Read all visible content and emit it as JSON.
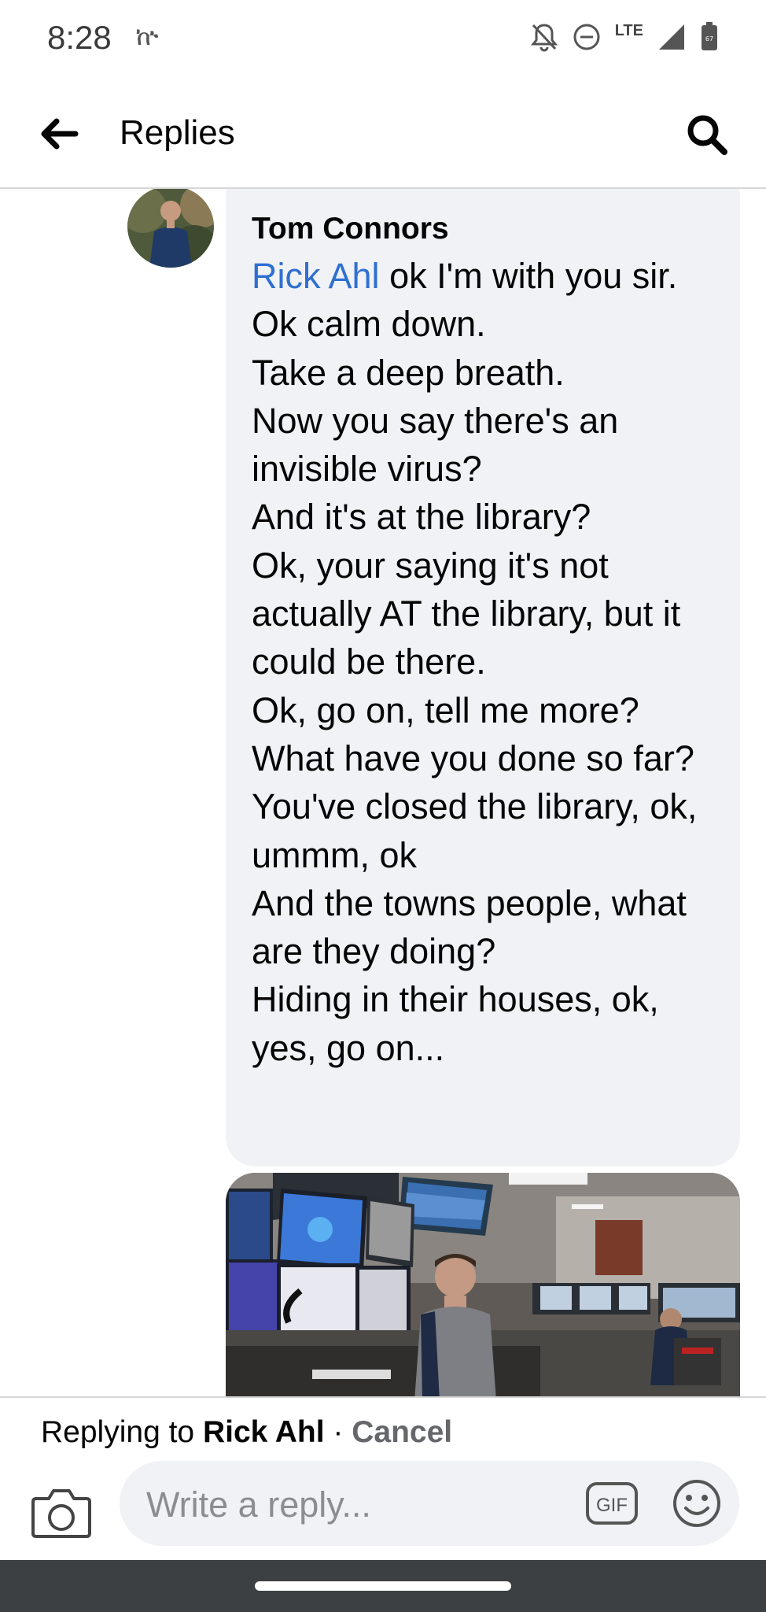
{
  "status_bar": {
    "time": "8:28",
    "glyph": "ኵ",
    "network": "LTE",
    "battery_level": "67",
    "icons": [
      "notifications-off-icon",
      "do-not-disturb-icon",
      "signal-icon",
      "battery-icon"
    ]
  },
  "header": {
    "title": "Replies",
    "back_icon": "arrow-left-icon",
    "search_icon": "search-icon"
  },
  "comment": {
    "author": "Tom Connors",
    "mention": "Rick Ahl",
    "text": " ok I'm with you sir.\nOk calm down.\nTake a deep breath.\nNow you say there's an invisible virus?\nAnd it's at the library?\nOk, your saying it's not actually AT the library, but it could be there.\nOk, go on, tell me more?\nWhat have you done so far?\nYou've closed the library, ok, ummm, ok\nAnd the towns people, what are they doing?\nHiding in their houses, ok, yes, go on..."
  },
  "reply_context": {
    "prefix": "Replying to ",
    "name": "Rick Ahl",
    "separator": " · ",
    "cancel": "Cancel"
  },
  "composer": {
    "placeholder": "Write a reply...",
    "gif_label": "GIF"
  },
  "colors": {
    "mention": "#2f6fd1",
    "bubble": "#f0f2f5",
    "nav_bar": "#3c4043"
  }
}
